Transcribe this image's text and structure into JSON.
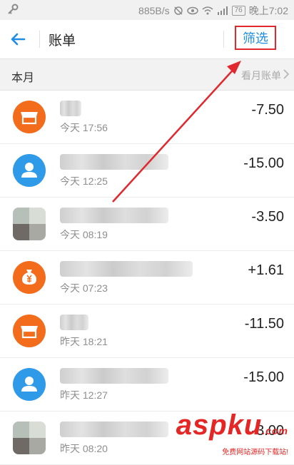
{
  "status_bar": {
    "speed": "885B/s",
    "battery": "76",
    "time": "晚上7:02"
  },
  "header": {
    "title": "账单",
    "filter_label": "筛选"
  },
  "month_bar": {
    "label": "本月",
    "link": "看月账单"
  },
  "transactions": [
    {
      "icon": "shop-icon",
      "time": "今天 17:56",
      "amount": "-7.50"
    },
    {
      "icon": "user-icon",
      "time": "今天 12:25",
      "amount": "-15.00"
    },
    {
      "icon": "photo-avatar",
      "time": "今天 08:19",
      "amount": "-3.50"
    },
    {
      "icon": "yen-bag-icon",
      "time": "今天 07:23",
      "amount": "+1.61"
    },
    {
      "icon": "shop-icon",
      "time": "昨天 18:21",
      "amount": "-11.50"
    },
    {
      "icon": "user-icon",
      "time": "昨天 12:27",
      "amount": "-15.00"
    },
    {
      "icon": "photo-avatar",
      "time": "昨天 08:20",
      "amount": "-3.00"
    }
  ],
  "watermark": {
    "brand": "aspku",
    "suffix": ".com",
    "tagline": "免费网站源码下载站!"
  },
  "colors": {
    "accent": "#1e8de4",
    "highlight_box": "#e0282e",
    "orange_icon": "#f26c1c",
    "blue_icon": "#2e9ae8"
  }
}
